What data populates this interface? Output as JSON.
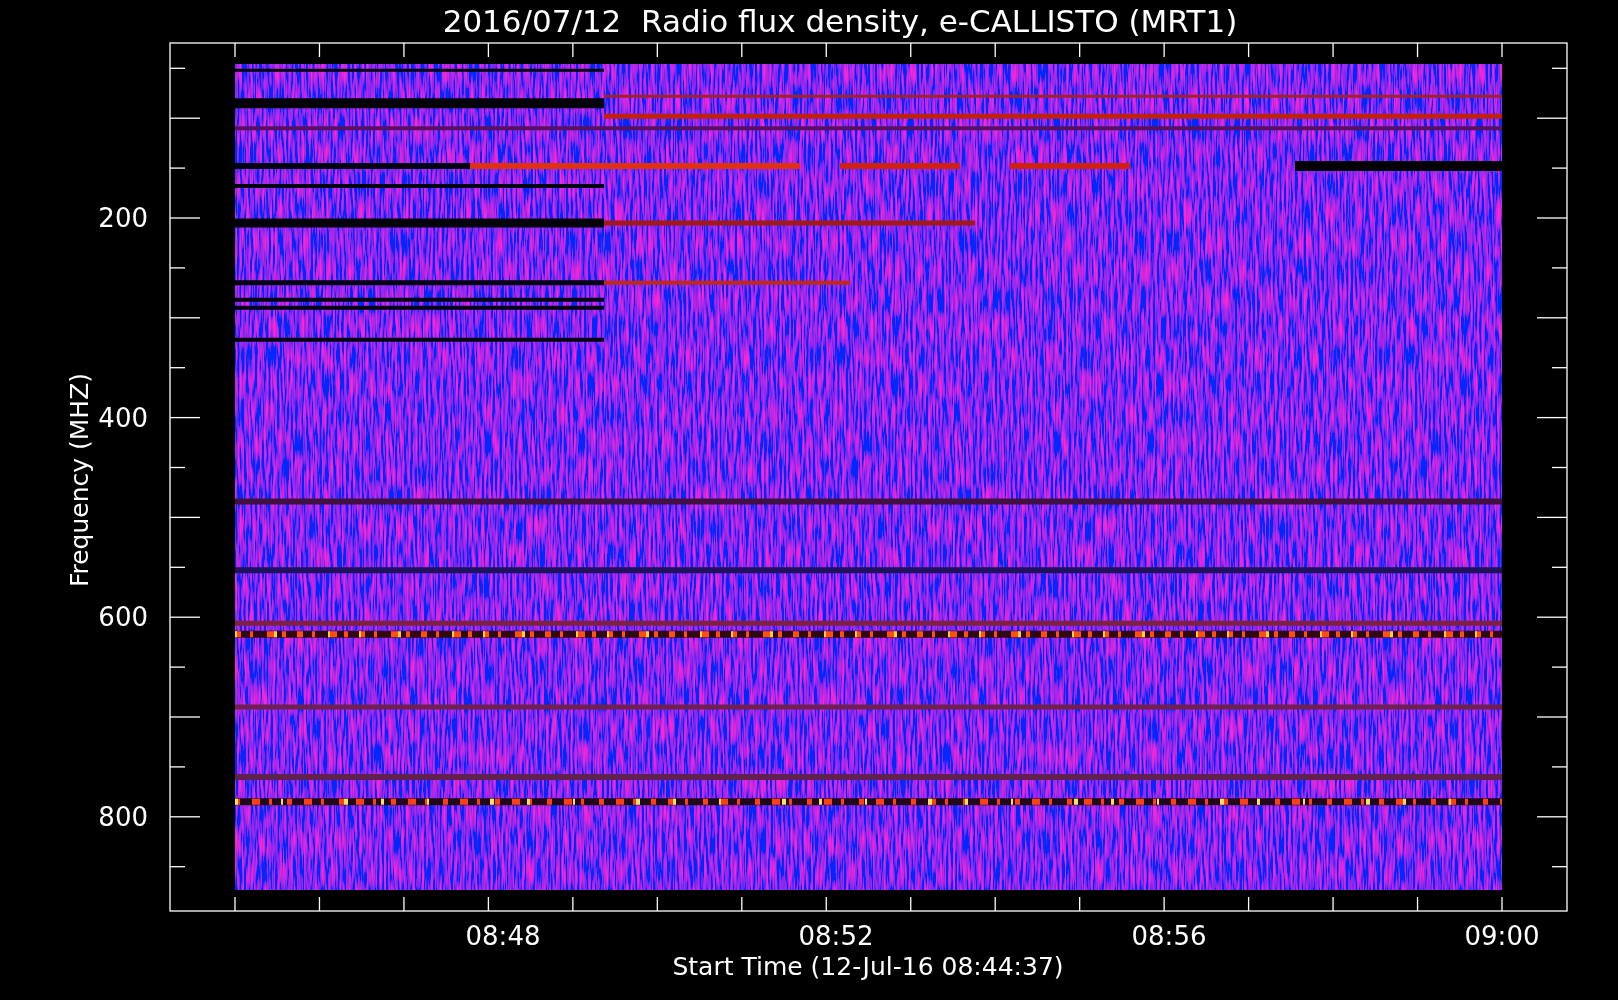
{
  "plot": {
    "title": "2016/07/12  Radio flux density, e-CALLISTO (MRT1)",
    "xlabel": "Start Time (12-Jul-16 08:44:37)",
    "ylabel": "Frequency (MHZ)",
    "x_tick_labels": [
      "08:48",
      "08:52",
      "08:56",
      "09:00"
    ],
    "y_tick_labels": [
      "200",
      "400",
      "600",
      "800"
    ]
  }
}
